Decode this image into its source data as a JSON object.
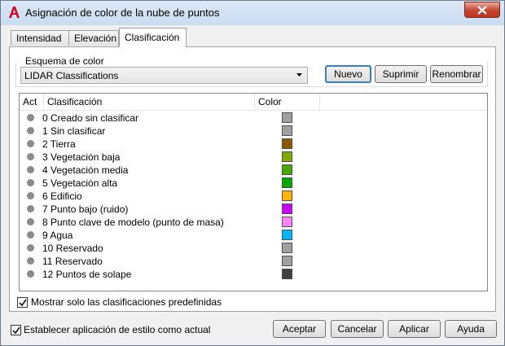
{
  "window": {
    "title": "Asignación de color de la nube de puntos"
  },
  "tabs": [
    {
      "label": "Intensidad",
      "active": false
    },
    {
      "label": "Elevación",
      "active": false
    },
    {
      "label": "Clasificación",
      "active": true
    }
  ],
  "scheme": {
    "group_label": "Esquema de color",
    "selected": "LIDAR Classifications",
    "buttons": {
      "new": "Nuevo",
      "delete": "Suprimir",
      "rename": "Renombrar"
    }
  },
  "table": {
    "headers": [
      "Act",
      "Clasificación",
      "Color"
    ],
    "rows": [
      {
        "label": "0 Creado sin clasificar",
        "color": "#a0a0a0"
      },
      {
        "label": "1 Sin clasificar",
        "color": "#a0a0a0"
      },
      {
        "label": "2 Tierra",
        "color": "#8b5a00"
      },
      {
        "label": "3 Vegetación baja",
        "color": "#7faa00"
      },
      {
        "label": "4 Vegetación media",
        "color": "#4aa800"
      },
      {
        "label": "5 Vegetación alta",
        "color": "#00a800"
      },
      {
        "label": "6 Edificio",
        "color": "#ffb400"
      },
      {
        "label": "7 Punto bajo (ruido)",
        "color": "#c800ff"
      },
      {
        "label": "8 Punto clave de modelo (punto de masa)",
        "color": "#ff82ff"
      },
      {
        "label": "9 Agua",
        "color": "#00b4ff"
      },
      {
        "label": "10 Reservado",
        "color": "#a0a0a0"
      },
      {
        "label": "11 Reservado",
        "color": "#a0a0a0"
      },
      {
        "label": "12 Puntos de solape",
        "color": "#404040"
      }
    ]
  },
  "options": {
    "show_predefined": {
      "label": "Mostrar solo las clasificaciones predefinidas",
      "checked": true
    },
    "set_current": {
      "label": "Establecer aplicación de estilo como actual",
      "checked": true
    }
  },
  "footer": {
    "accept": "Aceptar",
    "cancel": "Cancelar",
    "apply": "Aplicar",
    "help": "Ayuda"
  },
  "icons": {
    "app": "autocad-a-icon",
    "close": "close-icon",
    "dropdown": "chevron-down-icon",
    "check": "checkmark-icon"
  },
  "colors": {
    "app_icon": "#c8102e",
    "close_button": "#c7432f",
    "default_button_border": "#3c7fb1"
  }
}
